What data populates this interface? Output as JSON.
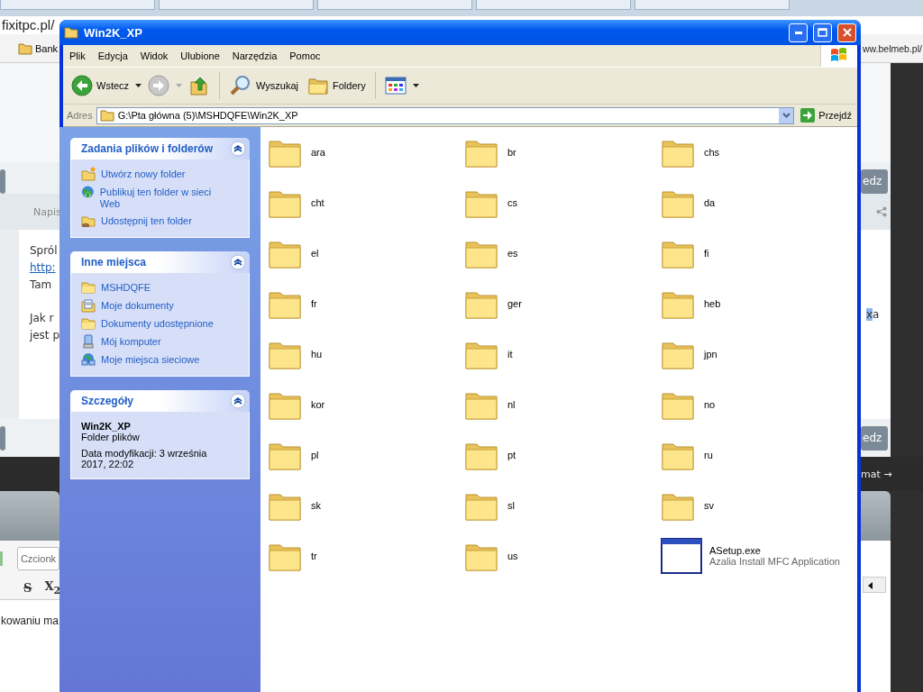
{
  "browser": {
    "url": "fixitpc.pl/",
    "bookmark": "Bank",
    "right_url": "ww.belmeb.pl/",
    "byline": "Napis",
    "post_paragraphs": [
      [
        {
          "text": "Spról",
          "kind": "text"
        },
        {
          "text": "http:",
          "kind": "link"
        },
        {
          "text": "Tam",
          "kind": "text"
        }
      ],
      [
        {
          "text": "Jak r",
          "kind": "text"
        },
        {
          "text": "jest p",
          "kind": "text"
        }
      ]
    ],
    "format_buttons": [
      {
        "label": "S",
        "kind": "strike"
      },
      {
        "label": "X$_{2}$",
        "kind": "subscript"
      }
    ],
    "font_field": "Czcionk",
    "editor_text": "kowaniu ma",
    "right_buttons": [
      "edz",
      "edz"
    ],
    "right_text": "xa",
    "next_topic": "mat →"
  },
  "window": {
    "title": "Win2K_XP"
  },
  "menu": [
    "Plik",
    "Edycja",
    "Widok",
    "Ulubione",
    "Narzędzia",
    "Pomoc"
  ],
  "toolbar": [
    {
      "kind": "back",
      "label": "Wstecz"
    },
    {
      "kind": "forward"
    },
    {
      "kind": "up"
    },
    {
      "kind": "search",
      "label": "Wyszukaj"
    },
    {
      "kind": "folders",
      "label": "Foldery"
    },
    {
      "kind": "views"
    }
  ],
  "address": {
    "label": "Adres",
    "path": "G:\\Pta główna (5)\\MSHDQFE\\Win2K_XP",
    "go": "Przejdź"
  },
  "panels": [
    {
      "title": "Zadania plików i folderów",
      "items": [
        "Utwórz nowy folder",
        "Publikuj ten folder w sieci Web",
        "Udostępnij ten folder"
      ]
    },
    {
      "title": "Inne miejsca",
      "items": [
        "MSHDQFE",
        "Moje dokumenty",
        "Dokumenty udostępnione",
        "Mój komputer",
        "Moje miejsca sieciowe"
      ]
    },
    {
      "title": "Szczegóły",
      "details": {
        "name": "Win2K_XP",
        "type": "Folder plików",
        "modified": "Data modyfikacji: 3 września 2017, 22:02"
      }
    }
  ],
  "files": [
    {
      "name": "ara",
      "kind": "folder"
    },
    {
      "name": "br",
      "kind": "folder"
    },
    {
      "name": "chs",
      "kind": "folder"
    },
    {
      "name": "cht",
      "kind": "folder"
    },
    {
      "name": "cs",
      "kind": "folder"
    },
    {
      "name": "da",
      "kind": "folder"
    },
    {
      "name": "el",
      "kind": "folder"
    },
    {
      "name": "es",
      "kind": "folder"
    },
    {
      "name": "fi",
      "kind": "folder"
    },
    {
      "name": "fr",
      "kind": "folder"
    },
    {
      "name": "ger",
      "kind": "folder"
    },
    {
      "name": "heb",
      "kind": "folder"
    },
    {
      "name": "hu",
      "kind": "folder"
    },
    {
      "name": "it",
      "kind": "folder"
    },
    {
      "name": "jpn",
      "kind": "folder"
    },
    {
      "name": "kor",
      "kind": "folder"
    },
    {
      "name": "nl",
      "kind": "folder"
    },
    {
      "name": "no",
      "kind": "folder"
    },
    {
      "name": "pl",
      "kind": "folder"
    },
    {
      "name": "pt",
      "kind": "folder"
    },
    {
      "name": "ru",
      "kind": "folder"
    },
    {
      "name": "sk",
      "kind": "folder"
    },
    {
      "name": "sl",
      "kind": "folder"
    },
    {
      "name": "sv",
      "kind": "folder"
    },
    {
      "name": "tr",
      "kind": "folder"
    },
    {
      "name": "us",
      "kind": "folder"
    },
    {
      "name": "ASetup.exe",
      "kind": "application",
      "description": "Azalia Install MFC Application"
    }
  ]
}
